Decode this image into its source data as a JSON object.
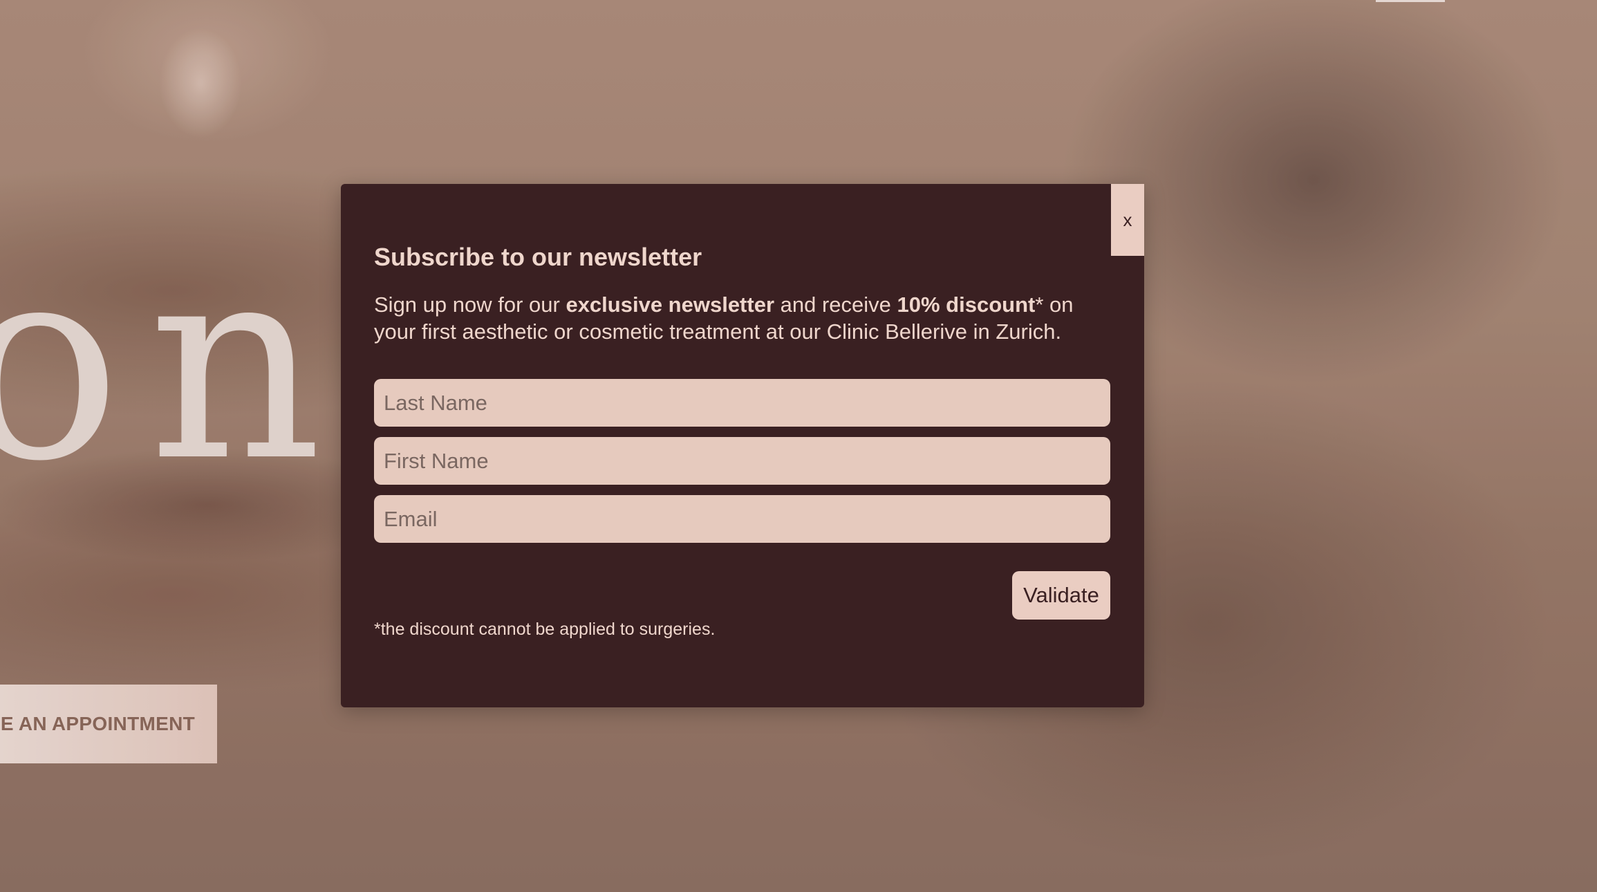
{
  "background": {
    "brand_word": "onoka",
    "appointment_button_label": "KE AN APPOINTMENT"
  },
  "modal": {
    "close_label": "x",
    "title": "Subscribe to our newsletter",
    "intro": {
      "part1": "Sign up now for our ",
      "bold1": "exclusive newsletter",
      "part2": " and receive ",
      "bold2": "10% discount",
      "part3": "* on your first aesthetic or cosmetic treatment at our Clinic Bellerive in Zurich."
    },
    "fields": {
      "last_name_placeholder": "Last Name",
      "first_name_placeholder": "First Name",
      "email_placeholder": "Email"
    },
    "validate_label": "Validate",
    "footnote": "*the discount cannot be applied to surgeries."
  },
  "colors": {
    "modal_background": "#3a2022",
    "modal_text": "#efd6cc",
    "field_background": "#e6cabe",
    "button_background": "#eacdc2"
  }
}
